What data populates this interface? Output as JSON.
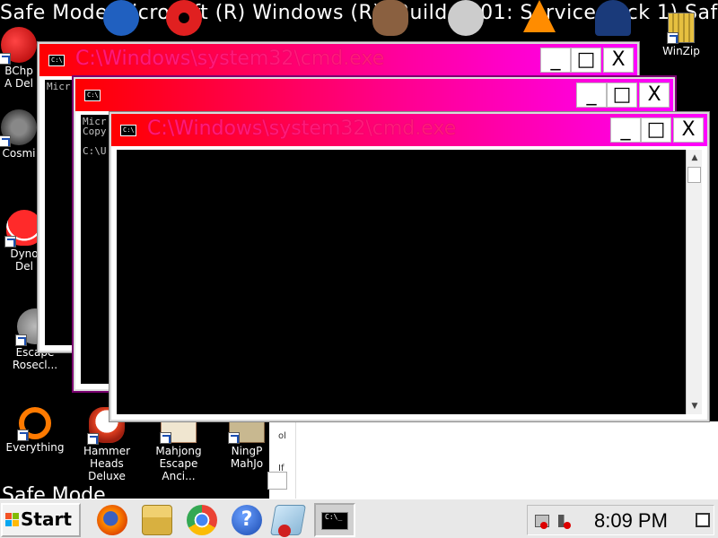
{
  "banner_top": "Safe Mode Microsoft (R) Windows (R) (Build 7601: Service Pack 1) Safe Mode",
  "banner_bottom": "Safe Mode",
  "desktop_icons": {
    "bchp": "BChp",
    "adel": "A Del",
    "cosmi": "Cosmi",
    "dyno": "Dyno",
    "dyno_del": "Del",
    "escape": "Escape",
    "escape_sub": "Rosecl...",
    "everything": "Everything",
    "hammer": "Hammer",
    "hammer_sub": "Heads Deluxe",
    "mahjong": "Mahjong",
    "mahjong_sub": "Escape Anci...",
    "ningp": "NingP",
    "ningp_sub": "MahJo",
    "winzip": "WinZip"
  },
  "windows": {
    "win1_title": "C:\\Windows\\system32\\cmd.exe",
    "win1_body": "Micr",
    "win2_title": "",
    "win2_body": "Micr\nCopy\n\nC:\\U",
    "win3_title": "C:\\Windows\\system32\\cmd.exe",
    "win3_body": "",
    "minimize": "_",
    "maximize": "□",
    "close": "X",
    "cmd_icon": "C:\\"
  },
  "bg_window": {
    "lines": "ol\n\nIf\nw"
  },
  "taskbar": {
    "start_label": "Start",
    "task_cmd_label": "C:\\_",
    "clock": "8:09 PM"
  },
  "colors": {
    "title_start": "#ff0000",
    "title_end": "#ff00ff",
    "title_text": "#ff1a7a",
    "console_bg": "#000000"
  }
}
